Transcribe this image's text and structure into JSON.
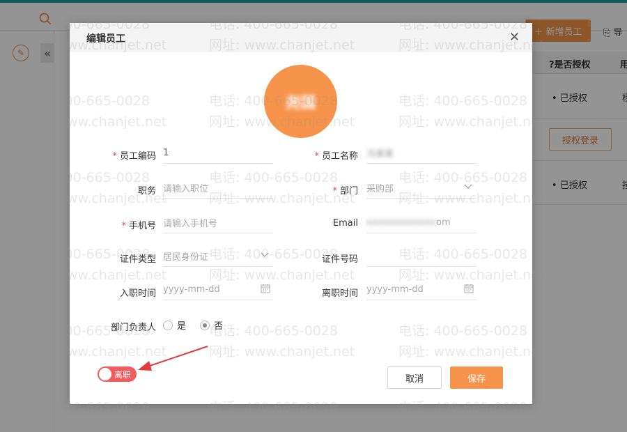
{
  "background": {
    "add_employee_label": "新增员工",
    "import_label": "导",
    "col_authorized": "是否授权",
    "col_cut": "用",
    "row1_status": "已授权",
    "row1_cut": "杨",
    "auth_login_label": "授权登录",
    "row3_status": "已授权",
    "row3_cut": "按"
  },
  "watermark": {
    "phone": "电话: 400-665-0028",
    "site": "网址: www.chanjet.net"
  },
  "modal": {
    "title": "编辑员工",
    "avatar_text": "尧国",
    "fields": {
      "emp_code": {
        "label": "员工编码",
        "value": "1"
      },
      "emp_name": {
        "label": "员工名称",
        "value": "冯某某"
      },
      "position": {
        "label": "职务",
        "placeholder": "请输入职位"
      },
      "department": {
        "label": "部门",
        "value": "采购部"
      },
      "mobile": {
        "label": "手机号",
        "placeholder": "请输入手机号"
      },
      "email": {
        "label": "Email",
        "value_blur": "xxxxxxxxxxxxx",
        "value_suffix": "om"
      },
      "id_type": {
        "label": "证件类型",
        "value": "居民身份证"
      },
      "id_number": {
        "label": "证件号码",
        "value": ""
      },
      "hire_date": {
        "label": "入职时间",
        "placeholder": "yyyy-mm-dd"
      },
      "leave_date": {
        "label": "离职时间",
        "placeholder": "yyyy-mm-dd"
      },
      "dept_head": {
        "label": "部门负责人",
        "opt_yes": "是",
        "opt_no": "否",
        "selected": "否"
      }
    },
    "toggle_label": "离职",
    "cancel_label": "取消",
    "save_label": "保存"
  },
  "colors": {
    "accent": "#f7934a",
    "teal": "#1aa39a",
    "toggle_red": "#f25c5c",
    "arrow_red": "#e0393e"
  }
}
